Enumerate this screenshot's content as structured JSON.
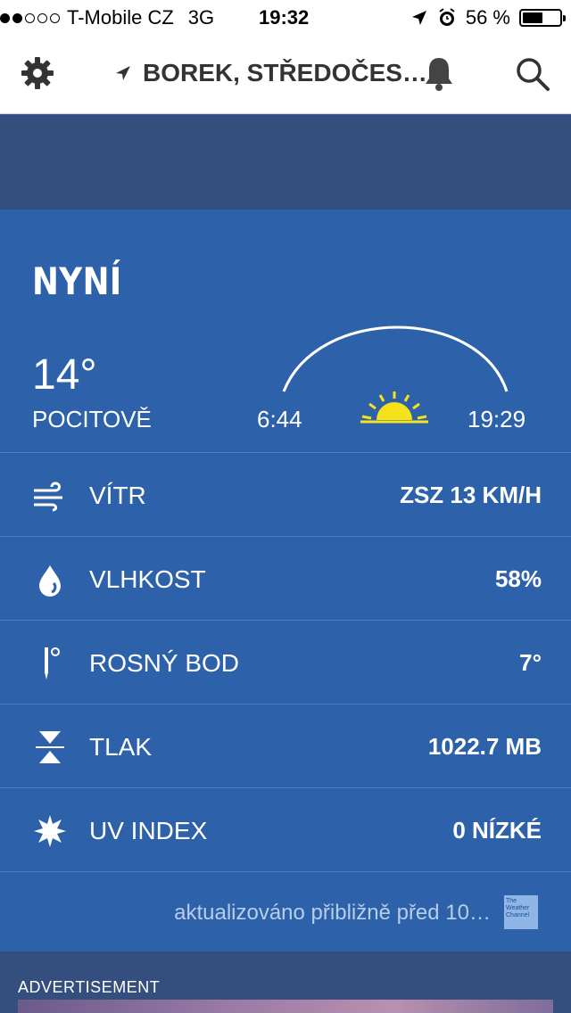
{
  "status_bar": {
    "carrier": "T-Mobile CZ",
    "network": "3G",
    "time": "19:32",
    "battery_percent": "56 %",
    "battery_level": 0.56,
    "signal_bars": 2
  },
  "header": {
    "location": "BOREK, STŘEDOČES…"
  },
  "now": {
    "title": "NYNÍ",
    "temperature": "14°",
    "feels_label": "POCITOVĚ",
    "sunrise": "6:44",
    "sunset": "19:29"
  },
  "details": [
    {
      "label": "VÍTR",
      "value": "ZSZ 13 KM/H",
      "icon": "wind-icon"
    },
    {
      "label": "VLHKOST",
      "value": "58%",
      "icon": "humidity-drop-icon"
    },
    {
      "label": "ROSNÝ BOD",
      "value": "7°",
      "icon": "thermometer-icon"
    },
    {
      "label": "TLAK",
      "value": "1022.7 MB",
      "icon": "pressure-icon"
    },
    {
      "label": "UV INDEX",
      "value": "0 NÍZKÉ",
      "icon": "uv-sun-icon"
    }
  ],
  "footer": {
    "updated": "aktualizováno přibližně před 10…",
    "logo_text": "The Weather Channel"
  },
  "ad": {
    "label": "ADVERTISEMENT"
  },
  "colors": {
    "card_background": "#2d62ab",
    "band_background": "#344e7d",
    "sun_yellow": "#f6e21a"
  }
}
